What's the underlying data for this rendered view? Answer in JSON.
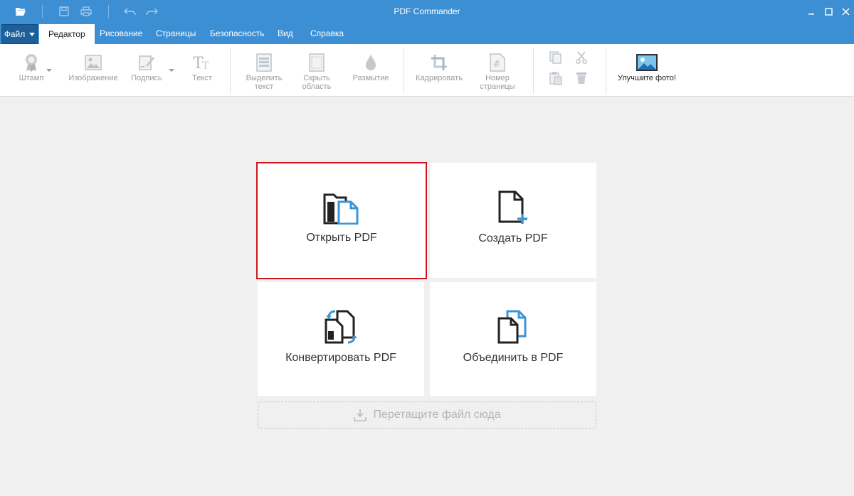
{
  "window": {
    "title": "PDF Commander"
  },
  "menu": {
    "file_label": "Файл",
    "tabs": [
      {
        "label": "Редактор",
        "active": true
      },
      {
        "label": "Рисование",
        "active": false
      },
      {
        "label": "Страницы",
        "active": false
      },
      {
        "label": "Безопасность",
        "active": false
      },
      {
        "label": "Вид",
        "active": false
      },
      {
        "label": "Справка",
        "active": false
      }
    ]
  },
  "ribbon": {
    "stamp": "Штамп",
    "image": "Изображение",
    "signature": "Подпись",
    "text": "Текст",
    "highlight_line1": "Выделить",
    "highlight_line2": "текст",
    "hide_line1": "Скрыть",
    "hide_line2": "область",
    "blur": "Размытие",
    "crop": "Кадрировать",
    "page_number_line1": "Номер",
    "page_number_line2": "страницы",
    "enhance_photo": "Улучшите фото!"
  },
  "start": {
    "open_pdf": "Открыть PDF",
    "create_pdf": "Создать PDF",
    "convert_pdf": "Конвертировать PDF",
    "merge_pdf": "Объединить в PDF",
    "dropzone": "Перетащите файл сюда"
  },
  "colors": {
    "titlebar": "#3c8fd3",
    "accent": "#3a96d6",
    "selection_border": "#d0161d"
  }
}
